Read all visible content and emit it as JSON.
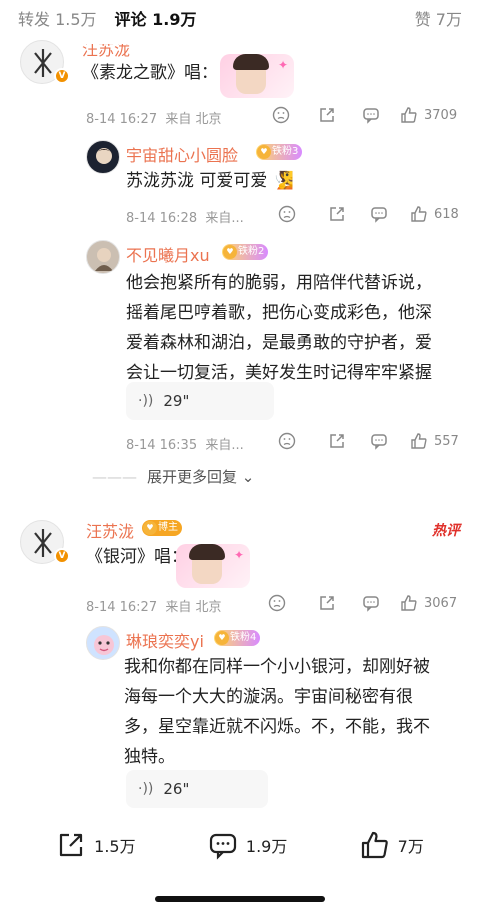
{
  "tabs": {
    "repost": "转发 1.5万",
    "comment": "评论 1.9万",
    "like": "赞 7万"
  },
  "comments": [
    {
      "user": "汪苏泷",
      "text": "《素龙之歌》唱：",
      "time": "8-14 16:27",
      "location": "来自 北京",
      "likes": "3709"
    },
    {
      "user": "宇宙甜心小圆脸",
      "badge": "铁粉3",
      "text": "苏泷苏泷 可爱可爱 🧏",
      "time": "8-14 16:28",
      "location": "来自...",
      "likes": "618"
    },
    {
      "user": "不见曦月xu",
      "badge": "铁粉2",
      "text_lines": [
        "他会抱紧所有的脆弱，用陪伴代替诉说，",
        "摇着尾巴哼着歌，把伤心变成彩色，他深",
        "爱着森林和湖泊，是最勇敢的守护者，爱",
        "会让一切复活，美好发生时记得牢牢紧握"
      ],
      "voice": "29\"",
      "time": "8-14 16:35",
      "location": "来自...",
      "likes": "557"
    },
    {
      "user": "汪苏泷",
      "badge": "博主",
      "hot": "热评",
      "text": "《银河》唱：",
      "time": "8-14 16:27",
      "location": "来自 北京",
      "likes": "3067"
    },
    {
      "user": "琳琅奕奕yi",
      "badge": "铁粉4",
      "text_lines": [
        "我和你都在同样一个小小银河，却刚好被",
        "海每一个大大的漩涡。宇宙间秘密有很",
        "多，星空靠近就不闪烁。不，不能，我不",
        "独特。"
      ],
      "voice": "26\""
    }
  ],
  "expand_label": "展开更多回复",
  "bottom": {
    "repost": "1.5万",
    "comment": "1.9万",
    "like": "7万"
  }
}
